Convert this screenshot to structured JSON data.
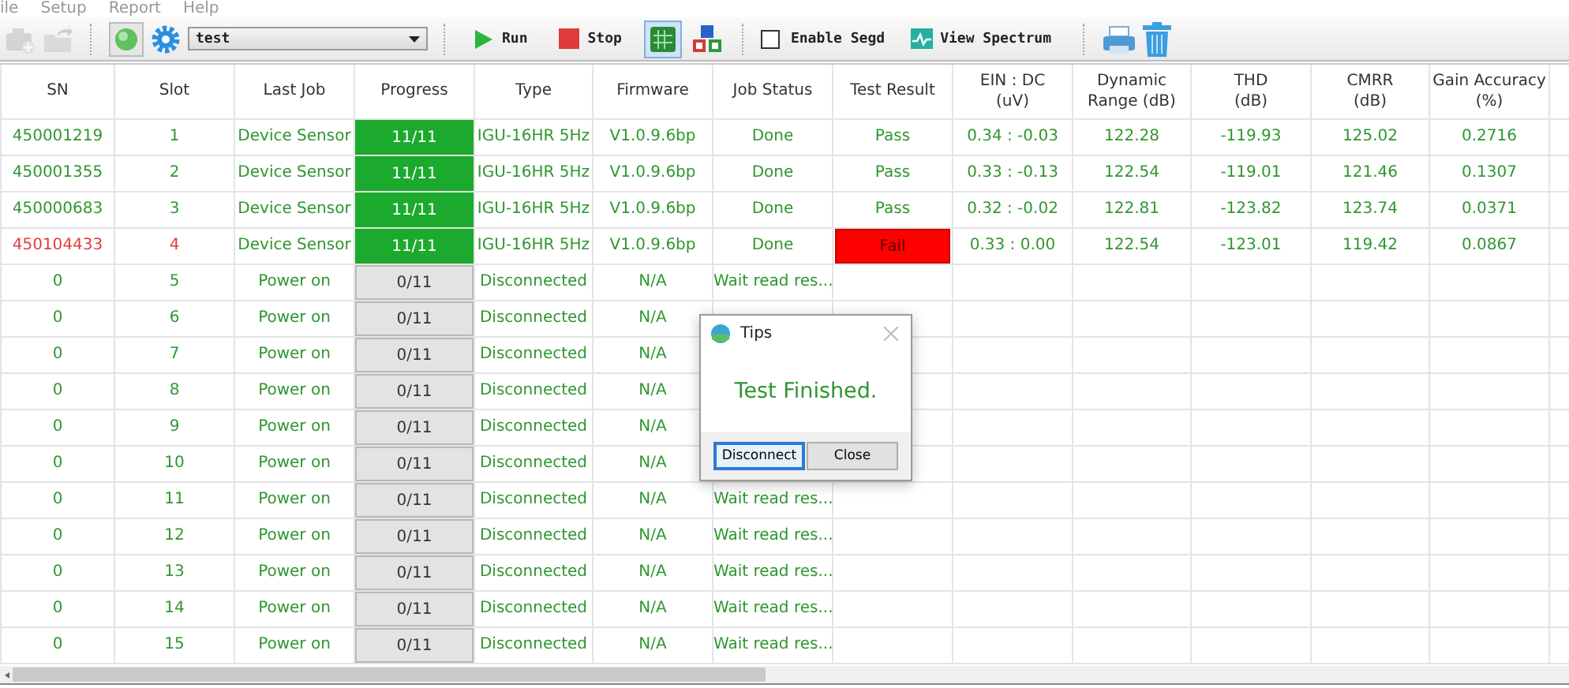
{
  "menu": [
    "ile",
    "Setup",
    "Report",
    "Help"
  ],
  "toolbar": [
    {
      "kind": "icon",
      "disabled": true
    },
    {
      "kind": "icon",
      "disabled": true
    },
    {
      "kind": "sep"
    },
    {
      "kind": "icon",
      "disabled": false
    },
    {
      "kind": "icon",
      "disabled": false
    },
    {
      "kind": "combo",
      "value": "test"
    },
    {
      "kind": "sep"
    },
    {
      "kind": "button",
      "label": "Run"
    },
    {
      "kind": "button",
      "label": "Stop"
    },
    {
      "kind": "toggle",
      "selected": true
    },
    {
      "kind": "toggle",
      "selected": false
    },
    {
      "kind": "sep"
    },
    {
      "kind": "check",
      "label": "Enable Segd",
      "checked": false
    },
    {
      "kind": "button",
      "label": "View Spectrum"
    },
    {
      "kind": "sep"
    },
    {
      "kind": "icon",
      "disabled": false
    },
    {
      "kind": "icon",
      "disabled": false
    }
  ],
  "table": {
    "columns": [
      "SN",
      "Slot",
      "Last Job",
      "Progress",
      "Type",
      "Firmware",
      "Job Status",
      "Test Result",
      "EIN : DC\n(uV)",
      "Dynamic\nRange (dB)",
      "THD\n(dB)",
      "CMRR\n(dB)",
      "Gain Accuracy\n(%)"
    ],
    "rows": [
      {
        "sn": "450001219",
        "slot": "1",
        "last_job": "Device Sensor",
        "progress": "11/11",
        "complete": true,
        "type": "IGU-16HR 5Hz",
        "firmware": "V1.0.9.6bp",
        "job_status": "Done",
        "test_result": "Pass",
        "failed": false,
        "ein_dc": "0.34 : -0.03",
        "dynamic_range": "122.28",
        "thd": "-119.93",
        "cmrr": "125.02",
        "gain_accuracy": "0.2716"
      },
      {
        "sn": "450001355",
        "slot": "2",
        "last_job": "Device Sensor",
        "progress": "11/11",
        "complete": true,
        "type": "IGU-16HR 5Hz",
        "firmware": "V1.0.9.6bp",
        "job_status": "Done",
        "test_result": "Pass",
        "failed": false,
        "ein_dc": "0.33 : -0.13",
        "dynamic_range": "122.54",
        "thd": "-119.01",
        "cmrr": "121.46",
        "gain_accuracy": "0.1307"
      },
      {
        "sn": "450000683",
        "slot": "3",
        "last_job": "Device Sensor",
        "progress": "11/11",
        "complete": true,
        "type": "IGU-16HR 5Hz",
        "firmware": "V1.0.9.6bp",
        "job_status": "Done",
        "test_result": "Pass",
        "failed": false,
        "ein_dc": "0.32 : -0.02",
        "dynamic_range": "122.81",
        "thd": "-123.82",
        "cmrr": "123.74",
        "gain_accuracy": "0.0371"
      },
      {
        "sn": "450104433",
        "slot": "4",
        "last_job": "Device Sensor",
        "progress": "11/11",
        "complete": true,
        "type": "IGU-16HR 5Hz",
        "firmware": "V1.0.9.6bp",
        "job_status": "Done",
        "test_result": "Fail",
        "failed": true,
        "ein_dc": "0.33 : 0.00",
        "dynamic_range": "122.54",
        "thd": "-123.01",
        "cmrr": "119.42",
        "gain_accuracy": "0.0867"
      },
      {
        "sn": "0",
        "slot": "5",
        "last_job": "Power on",
        "progress": "0/11",
        "complete": false,
        "type": "Disconnected",
        "firmware": "N/A",
        "job_status": "Wait read res...",
        "failed": false
      },
      {
        "sn": "0",
        "slot": "6",
        "last_job": "Power on",
        "progress": "0/11",
        "complete": false,
        "type": "Disconnected",
        "firmware": "N/A",
        "failed": false
      },
      {
        "sn": "0",
        "slot": "7",
        "last_job": "Power on",
        "progress": "0/11",
        "complete": false,
        "type": "Disconnected",
        "firmware": "N/A",
        "failed": false
      },
      {
        "sn": "0",
        "slot": "8",
        "last_job": "Power on",
        "progress": "0/11",
        "complete": false,
        "type": "Disconnected",
        "firmware": "N/A",
        "failed": false
      },
      {
        "sn": "0",
        "slot": "9",
        "last_job": "Power on",
        "progress": "0/11",
        "complete": false,
        "type": "Disconnected",
        "firmware": "N/A",
        "failed": false
      },
      {
        "sn": "0",
        "slot": "10",
        "last_job": "Power on",
        "progress": "0/11",
        "complete": false,
        "type": "Disconnected",
        "firmware": "N/A",
        "failed": false
      },
      {
        "sn": "0",
        "slot": "11",
        "last_job": "Power on",
        "progress": "0/11",
        "complete": false,
        "type": "Disconnected",
        "firmware": "N/A",
        "job_status": "Wait read res...",
        "failed": false
      },
      {
        "sn": "0",
        "slot": "12",
        "last_job": "Power on",
        "progress": "0/11",
        "complete": false,
        "type": "Disconnected",
        "firmware": "N/A",
        "job_status": "Wait read res...",
        "failed": false
      },
      {
        "sn": "0",
        "slot": "13",
        "last_job": "Power on",
        "progress": "0/11",
        "complete": false,
        "type": "Disconnected",
        "firmware": "N/A",
        "job_status": "Wait read res...",
        "failed": false
      },
      {
        "sn": "0",
        "slot": "14",
        "last_job": "Power on",
        "progress": "0/11",
        "complete": false,
        "type": "Disconnected",
        "firmware": "N/A",
        "job_status": "Wait read res...",
        "failed": false
      },
      {
        "sn": "0",
        "slot": "15",
        "last_job": "Power on",
        "progress": "0/11",
        "complete": false,
        "type": "Disconnected",
        "firmware": "N/A",
        "job_status": "Wait read res...",
        "failed": false
      }
    ]
  },
  "dialog": {
    "title": "Tips",
    "message": "Test Finished.",
    "buttons": [
      {
        "label": "Disconnect",
        "selected": true
      },
      {
        "label": "Close",
        "selected": false
      }
    ]
  }
}
